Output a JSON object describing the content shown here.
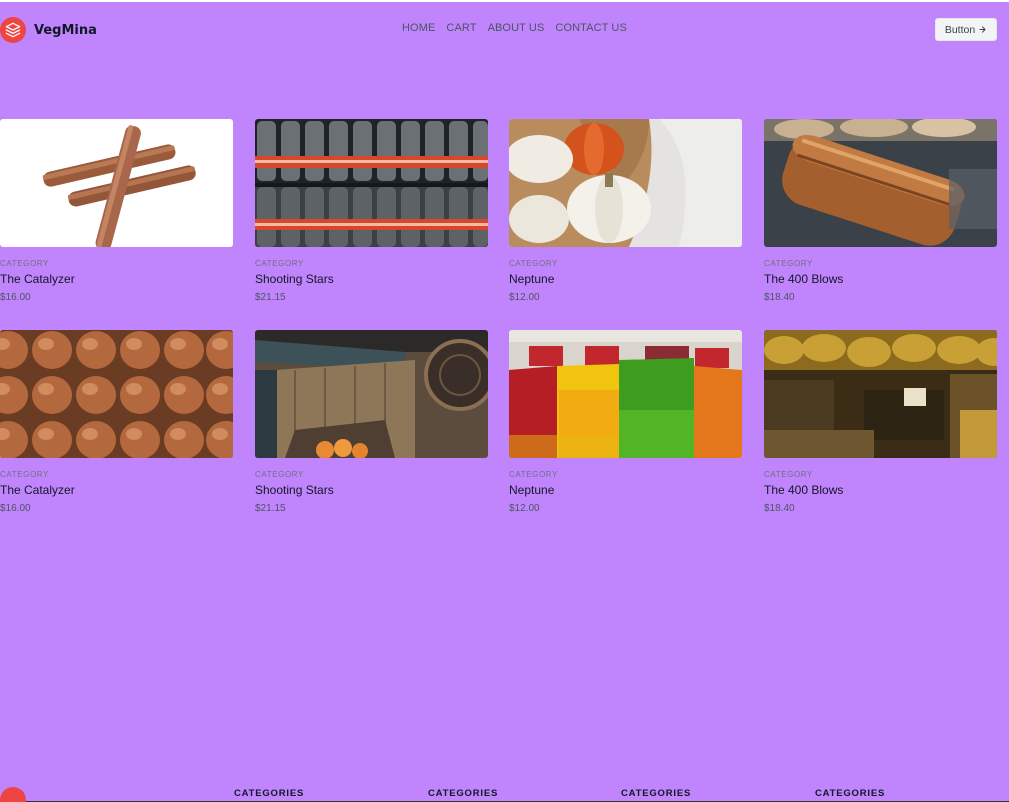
{
  "header": {
    "brand": "VegMina",
    "nav": [
      "HOME",
      "CART",
      "ABOUT US",
      "CONTACT US"
    ],
    "button_label": "Button",
    "button_icon": "arrow-right-icon"
  },
  "products": [
    {
      "category": "CATEGORY",
      "title": "The Catalyzer",
      "price": "$16.00",
      "image": "cinnamon-sticks"
    },
    {
      "category": "CATEGORY",
      "title": "Shooting Stars",
      "price": "$21.15",
      "image": "soda-bottles"
    },
    {
      "category": "CATEGORY",
      "title": "Neptune",
      "price": "$12.00",
      "image": "pumpkins"
    },
    {
      "category": "CATEGORY",
      "title": "The 400 Blows",
      "price": "$18.40",
      "image": "bread-loaf"
    },
    {
      "category": "CATEGORY",
      "title": "The Catalyzer",
      "price": "$16.00",
      "image": "eggs"
    },
    {
      "category": "CATEGORY",
      "title": "Shooting Stars",
      "price": "$21.15",
      "image": "wooden-crates"
    },
    {
      "category": "CATEGORY",
      "title": "Neptune",
      "price": "$12.00",
      "image": "bell-peppers"
    },
    {
      "category": "CATEGORY",
      "title": "The 400 Blows",
      "price": "$18.40",
      "image": "banana-market"
    }
  ],
  "footer": {
    "columns": [
      "CATEGORIES",
      "CATEGORIES",
      "CATEGORIES",
      "CATEGORIES"
    ]
  },
  "colors": {
    "background": "#c084fc",
    "brand_accent": "#ef4444"
  }
}
